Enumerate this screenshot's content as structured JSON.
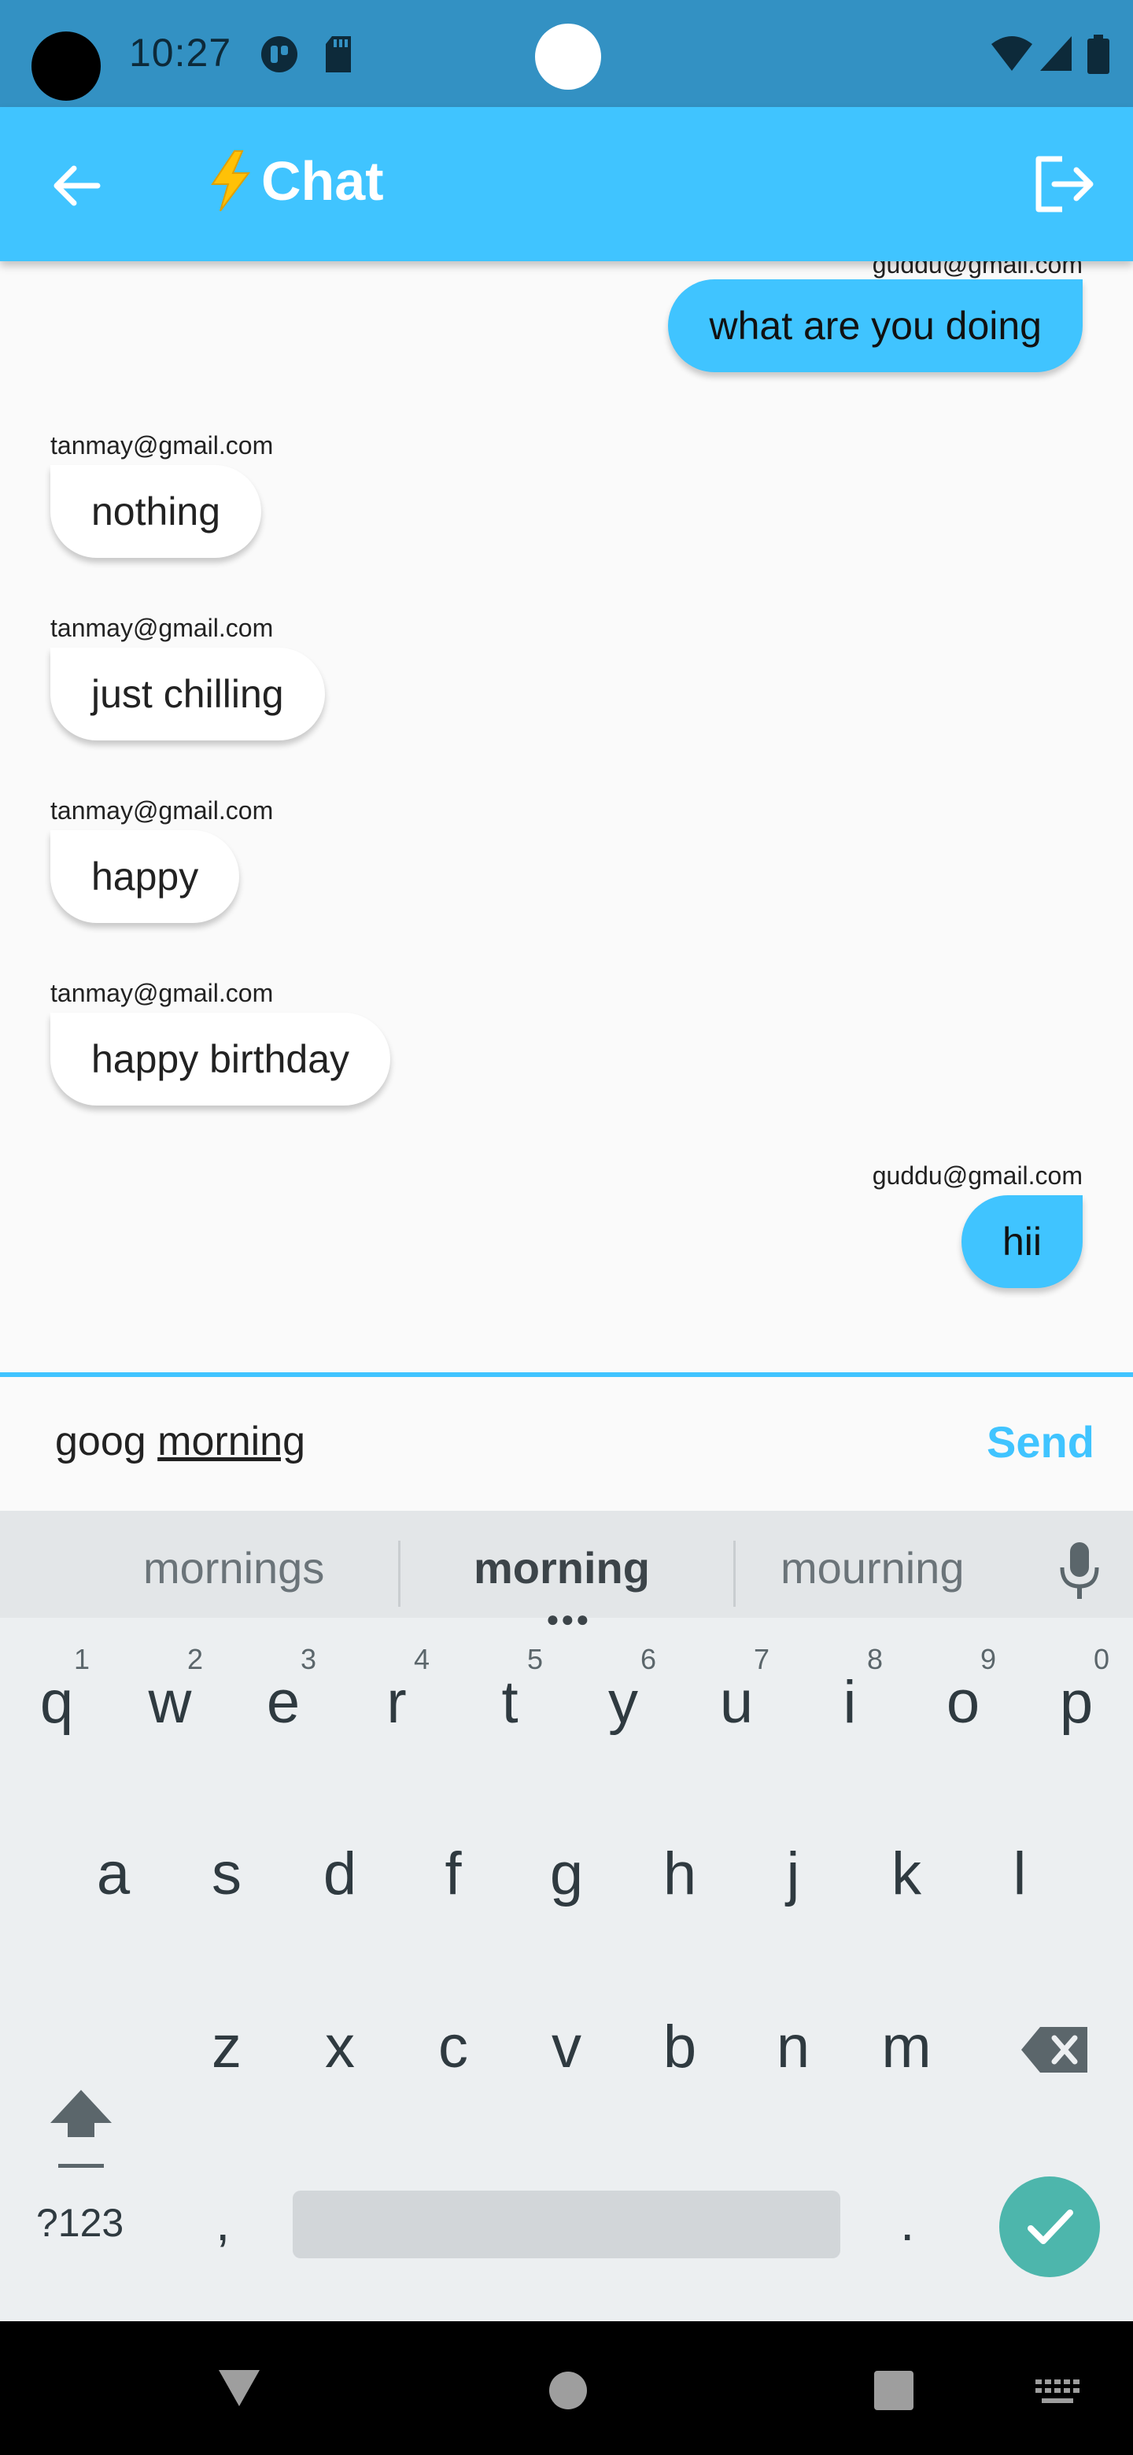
{
  "status_bar": {
    "time": "10:27"
  },
  "app_bar": {
    "title": "Chat",
    "title_emoji": "⚡",
    "color": "#40c4ff"
  },
  "messages": [
    {
      "sender": "guddu@gmail.com",
      "text": "what are you doing",
      "side": "out"
    },
    {
      "sender": "tanmay@gmail.com",
      "text": "nothing",
      "side": "in"
    },
    {
      "sender": "tanmay@gmail.com",
      "text": "just chilling",
      "side": "in"
    },
    {
      "sender": "tanmay@gmail.com",
      "text": "happy",
      "side": "in"
    },
    {
      "sender": "tanmay@gmail.com",
      "text": "happy birthday",
      "side": "in"
    },
    {
      "sender": "guddu@gmail.com",
      "text": "hii",
      "side": "out"
    }
  ],
  "composer": {
    "typed": "goog",
    "composing": "morning",
    "send_label": "Send"
  },
  "keyboard": {
    "suggestions": [
      "mornings",
      "morning",
      "mourning"
    ],
    "row1": [
      "q",
      "w",
      "e",
      "r",
      "t",
      "y",
      "u",
      "i",
      "o",
      "p"
    ],
    "row1_hints": [
      "1",
      "2",
      "3",
      "4",
      "5",
      "6",
      "7",
      "8",
      "9",
      "0"
    ],
    "row2": [
      "a",
      "s",
      "d",
      "f",
      "g",
      "h",
      "j",
      "k",
      "l"
    ],
    "row3": [
      "z",
      "x",
      "c",
      "v",
      "b",
      "n",
      "m"
    ],
    "symbols_label": "?123",
    "comma": ",",
    "period": "."
  }
}
